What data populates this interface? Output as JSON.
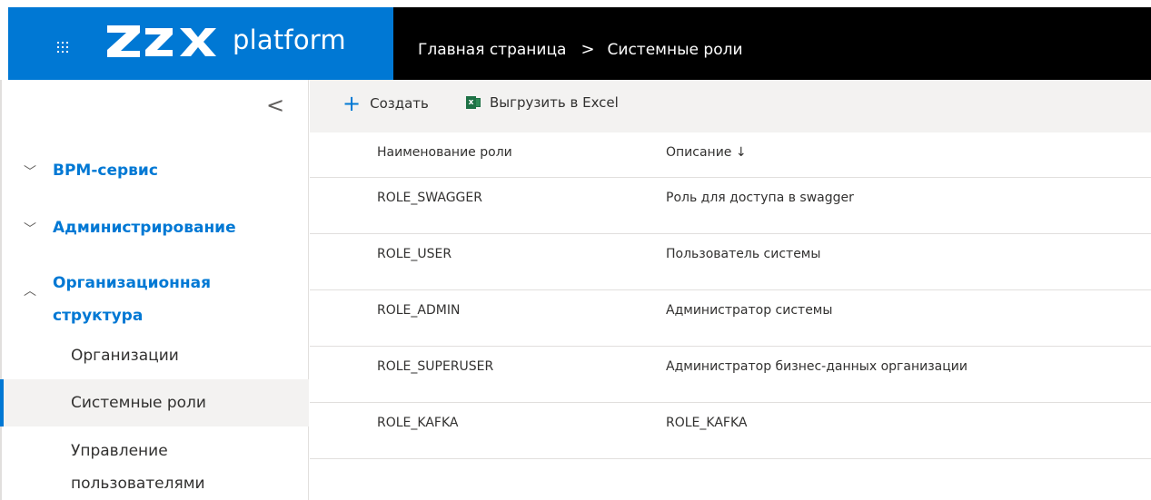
{
  "header": {
    "brand_text": "platform",
    "breadcrumb": [
      "Главная страница",
      "Системные роли"
    ],
    "separator": ">",
    "brand_color": "#0078d4"
  },
  "sidebar": {
    "collapse_glyph": "<",
    "groups": [
      {
        "label": "BPM-сервис",
        "expanded": false
      },
      {
        "label": "Администрирование",
        "expanded": false
      },
      {
        "label": "Организационная структура",
        "label_lines": [
          "Организационная",
          "структура"
        ],
        "expanded": true
      }
    ],
    "subitems": [
      {
        "label": "Организации",
        "selected": false
      },
      {
        "label": "Системные роли",
        "selected": true
      },
      {
        "label": "Управление пользователями",
        "label_lines": [
          "Управление",
          "пользователями"
        ],
        "selected": false
      }
    ]
  },
  "commands": {
    "create_label": "Создать",
    "export_label": "Выгрузить в Excel"
  },
  "table": {
    "columns": [
      "Наименование роли",
      "Описание ↓"
    ],
    "rows": [
      [
        "ROLE_SWAGGER",
        "Роль для доступа в swagger"
      ],
      [
        "ROLE_USER",
        "Пользователь системы"
      ],
      [
        "ROLE_ADMIN",
        "Администратор системы"
      ],
      [
        "ROLE_SUPERUSER",
        "Администратор бизнес-данных организации"
      ],
      [
        "ROLE_KAFKA",
        "ROLE_KAFKA"
      ]
    ]
  }
}
